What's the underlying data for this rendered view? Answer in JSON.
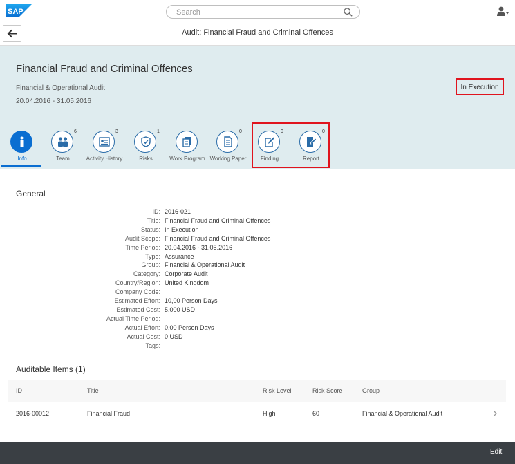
{
  "shell": {
    "logo_text": "SAP",
    "search_placeholder": "Search",
    "brand_color": "#0a6ed1"
  },
  "page_header": {
    "title": "Audit: Financial Fraud and Criminal Offences"
  },
  "object_header": {
    "title": "Financial Fraud and Criminal Offences",
    "subtitle": "Financial & Operational Audit",
    "date_range": "20.04.2016 - 31.05.2016",
    "status": "In Execution"
  },
  "tabs": [
    {
      "label": "Info",
      "count": "",
      "icon": "info-icon",
      "active": true
    },
    {
      "label": "Team",
      "count": "6",
      "icon": "team-icon"
    },
    {
      "label": "Activity History",
      "count": "3",
      "icon": "activity-history-icon"
    },
    {
      "label": "Risks",
      "count": "1",
      "icon": "risks-icon"
    },
    {
      "label": "Work Program",
      "count": "",
      "icon": "work-program-icon"
    },
    {
      "label": "Working Paper",
      "count": "0",
      "icon": "working-paper-icon"
    },
    {
      "label": "Finding",
      "count": "0",
      "icon": "finding-icon"
    },
    {
      "label": "Report",
      "count": "0",
      "icon": "report-icon"
    }
  ],
  "general": {
    "title": "General",
    "fields": [
      {
        "label": "ID:",
        "value": "2016-021"
      },
      {
        "label": "Title:",
        "value": "Financial Fraud and Criminal Offences"
      },
      {
        "label": "Status:",
        "value": "In Execution"
      },
      {
        "label": "Audit Scope:",
        "value": "Financial Fraud and Criminal Offences"
      },
      {
        "label": "Time Period:",
        "value": "20.04.2016  -  31.05.2016"
      },
      {
        "label": "Type:",
        "value": "Assurance"
      },
      {
        "label": "Group:",
        "value": "Financial & Operational Audit"
      },
      {
        "label": "Category:",
        "value": "Corporate Audit"
      },
      {
        "label": "Country/Region:",
        "value": "United Kingdom"
      },
      {
        "label": "Company Code:",
        "value": ""
      },
      {
        "label": "Estimated Effort:",
        "value": "10,00 Person Days"
      },
      {
        "label": "Estimated Cost:",
        "value": "5.000 USD"
      },
      {
        "label": "Actual Time Period:",
        "value": ""
      },
      {
        "label": "Actual Effort:",
        "value": "0,00 Person Days"
      },
      {
        "label": "Actual Cost:",
        "value": "0 USD"
      },
      {
        "label": "Tags:",
        "value": ""
      }
    ]
  },
  "auditable_items": {
    "title": "Auditable Items (1)",
    "columns": [
      "ID",
      "Title",
      "Risk Level",
      "Risk Score",
      "Group"
    ],
    "rows": [
      [
        "2016-00012",
        "Financial Fraud",
        "High",
        "60",
        "Financial & Operational Audit"
      ]
    ]
  },
  "footer": {
    "edit_label": "Edit"
  }
}
